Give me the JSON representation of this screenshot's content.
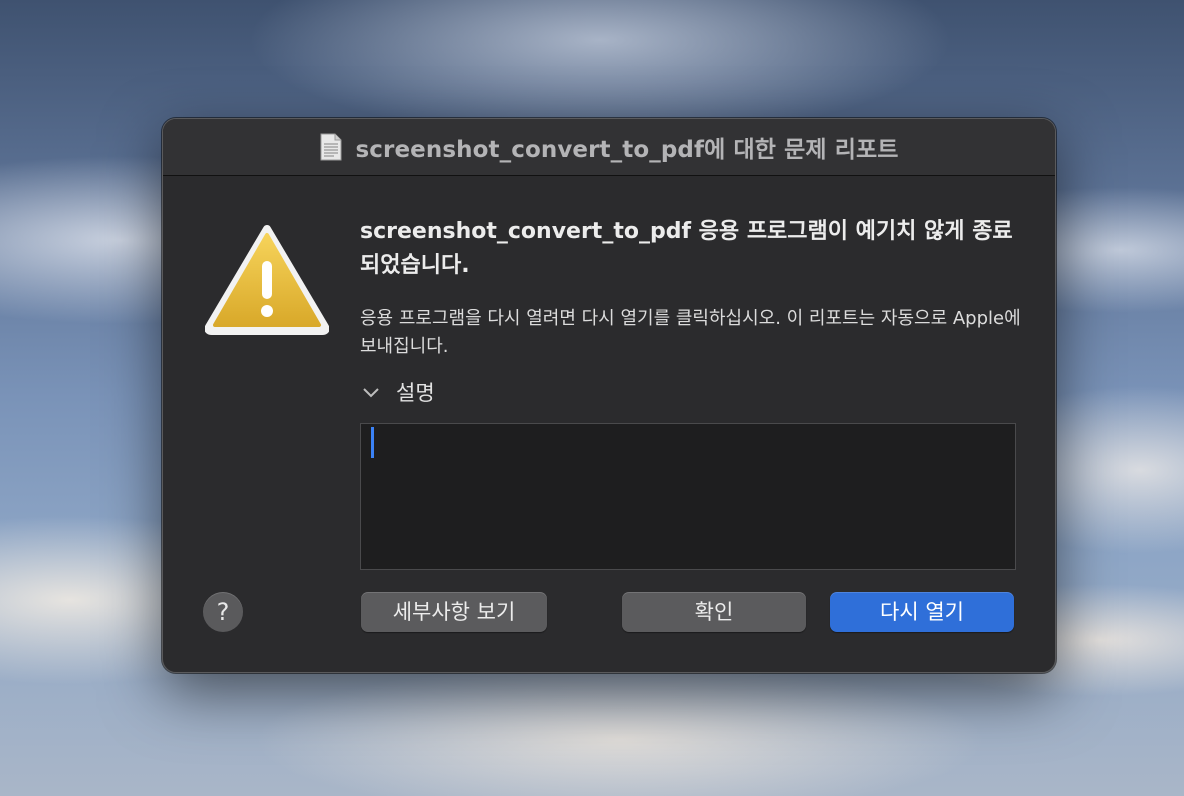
{
  "window": {
    "title": "screenshot_convert_to_pdf에 대한 문제 리포트",
    "title_icon": "document-icon"
  },
  "alert": {
    "icon": "warning-icon",
    "headline": "screenshot_convert_to_pdf 응용 프로그램이 예기치 않게 종료되었습니다.",
    "message": "응용 프로그램을 다시 열려면 다시 열기를 클릭하십시오. 이 리포트는 자동으로 Apple에 보내집니다."
  },
  "description": {
    "toggle_label": "설명",
    "toggle_icon": "chevron-down-icon",
    "value": ""
  },
  "buttons": {
    "help": "?",
    "details": "세부사항 보기",
    "ok": "확인",
    "reopen": "다시 열기"
  },
  "colors": {
    "dialog_bg": "#2b2b2d",
    "primary_button": "#2f6fd9",
    "secondary_button": "#5b5b5d",
    "caret": "#3b82f6"
  }
}
